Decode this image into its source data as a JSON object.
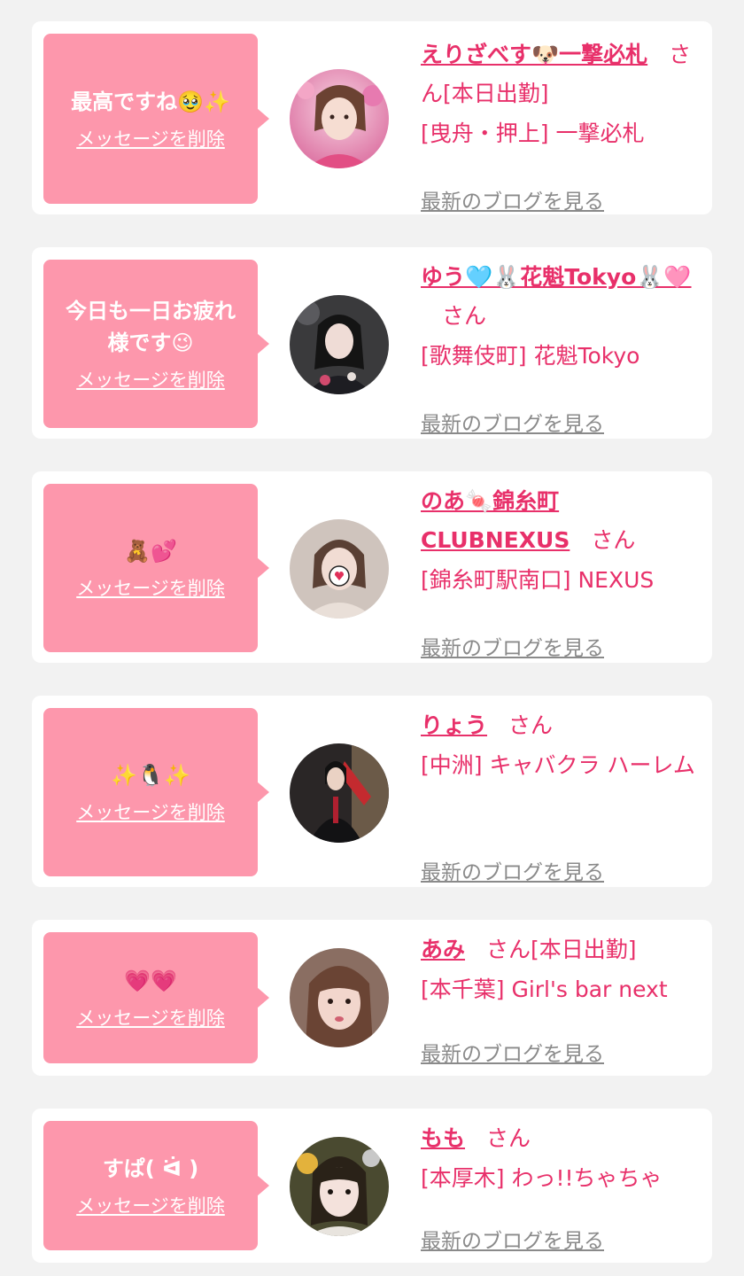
{
  "delete_label": "メッセージを削除",
  "blog_label": "最新のブログを見る",
  "san_label": "さん",
  "cards": [
    {
      "message": "最高ですね🥹✨",
      "name": "えりざべす🐶一撃必札",
      "badge": "[本日出勤]",
      "shop": "[曳舟・押上] 一撃必札"
    },
    {
      "message": "今日も一日お疲れ\n様です😉",
      "name": "ゆう🩵🐰花魁Tokyo🐰🩷",
      "badge": "",
      "shop": "[歌舞伎町] 花魁Tokyo"
    },
    {
      "message": "🧸💕",
      "name": "のあ🍬錦糸町CLUBNEXUS",
      "badge": "",
      "shop": "[錦糸町駅南口] NEXUS"
    },
    {
      "message": "✨🐧✨",
      "name": "りょう",
      "badge": "",
      "shop": "[中洲] キャバクラ ハーレム"
    },
    {
      "message": "💗💗",
      "name": "あみ",
      "badge": "[本日出勤]",
      "shop": "[本千葉] Girl's bar next"
    },
    {
      "message": "すぱ( ᐛ )",
      "name": "もも",
      "badge": "",
      "shop": "[本厚木] わっ!!ちゃちゃ"
    }
  ],
  "colors": {
    "page_bg": "#f2f2f2",
    "card_bg": "#ffffff",
    "bubble_bg": "#fd97ac",
    "accent": "#e8306a",
    "blog_link": "#8a8a8a"
  }
}
